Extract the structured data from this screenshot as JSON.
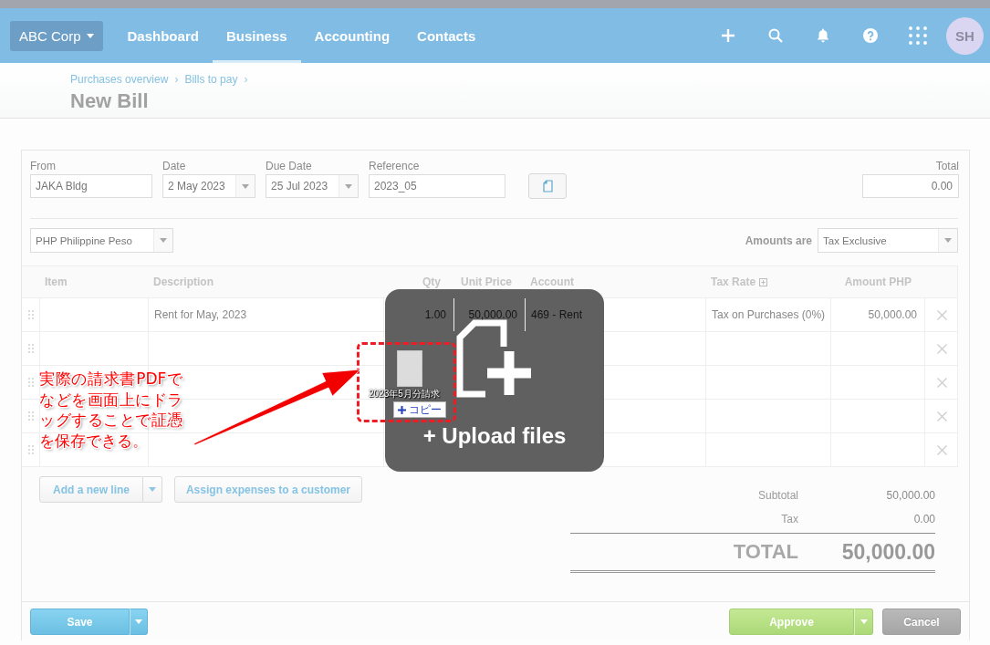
{
  "top_nav": {
    "org_switcher": "ABC Corp",
    "tabs": [
      {
        "label": "Dashboard",
        "selected": false
      },
      {
        "label": "Business",
        "selected": true
      },
      {
        "label": "Accounting",
        "selected": false
      },
      {
        "label": "Contacts",
        "selected": false
      }
    ],
    "avatar": "SH"
  },
  "page_header": {
    "breadcrumbs": [
      {
        "label": "Purchases overview",
        "separator": "›"
      },
      {
        "label": "Bills to pay",
        "separator": "›"
      }
    ],
    "title": "New Bill"
  },
  "bill_details": {
    "fields": [
      {
        "label": "From",
        "value": "JAKA Bldg",
        "kind": "text"
      },
      {
        "label": "Date",
        "value": "2 May 2023",
        "kind": "dropdown"
      },
      {
        "label": "Due Date",
        "value": "25 Jul 2023",
        "kind": "dropdown"
      },
      {
        "label": "Reference",
        "value": "2023_05",
        "kind": "text"
      }
    ],
    "total": {
      "label": "Total",
      "value": "0.00"
    },
    "currency": "PHP Philippine Peso",
    "amounts_are": {
      "label": "Amounts are",
      "value": "Tax Exclusive"
    }
  },
  "line_items": {
    "columns": [
      {
        "label": "Item",
        "expandable": false
      },
      {
        "label": "Description",
        "expandable": false
      },
      {
        "label": "Qty",
        "expandable": false
      },
      {
        "label": "Unit Price",
        "expandable": false
      },
      {
        "label": "Account",
        "expandable": false
      },
      {
        "label": "Tax Rate",
        "expandable": true
      },
      {
        "label": "Amount PHP",
        "expandable": false
      }
    ],
    "rows": [
      {
        "description": "Rent for May, 2023",
        "qty": "1.00",
        "unit_price": "50,000.00",
        "account": "469 - Rent",
        "tax_rate": "Tax on Purchases (0%)",
        "amount": "50,000.00"
      },
      {},
      {},
      {},
      {}
    ]
  },
  "line_actions": {
    "add_line": "Add a new line",
    "assign_expenses": "Assign expenses to a customer"
  },
  "totals": {
    "subtotal": {
      "label": "Subtotal",
      "value": "50,000.00"
    },
    "tax": {
      "label": "Tax",
      "value": "0.00"
    },
    "total": {
      "label": "TOTAL",
      "value": "50,000.00"
    }
  },
  "footer": {
    "save": "Save",
    "approve": "Approve",
    "cancel": "Cancel"
  },
  "upload_overlay": {
    "label": "+ Upload files"
  },
  "drag_preview": {
    "file_name": "2023年5月分請求",
    "badge": "コピー"
  },
  "annotation": {
    "text": "実際の請求書PDFでなどを画面上にドラッグすることで証憑を保存できる。"
  }
}
